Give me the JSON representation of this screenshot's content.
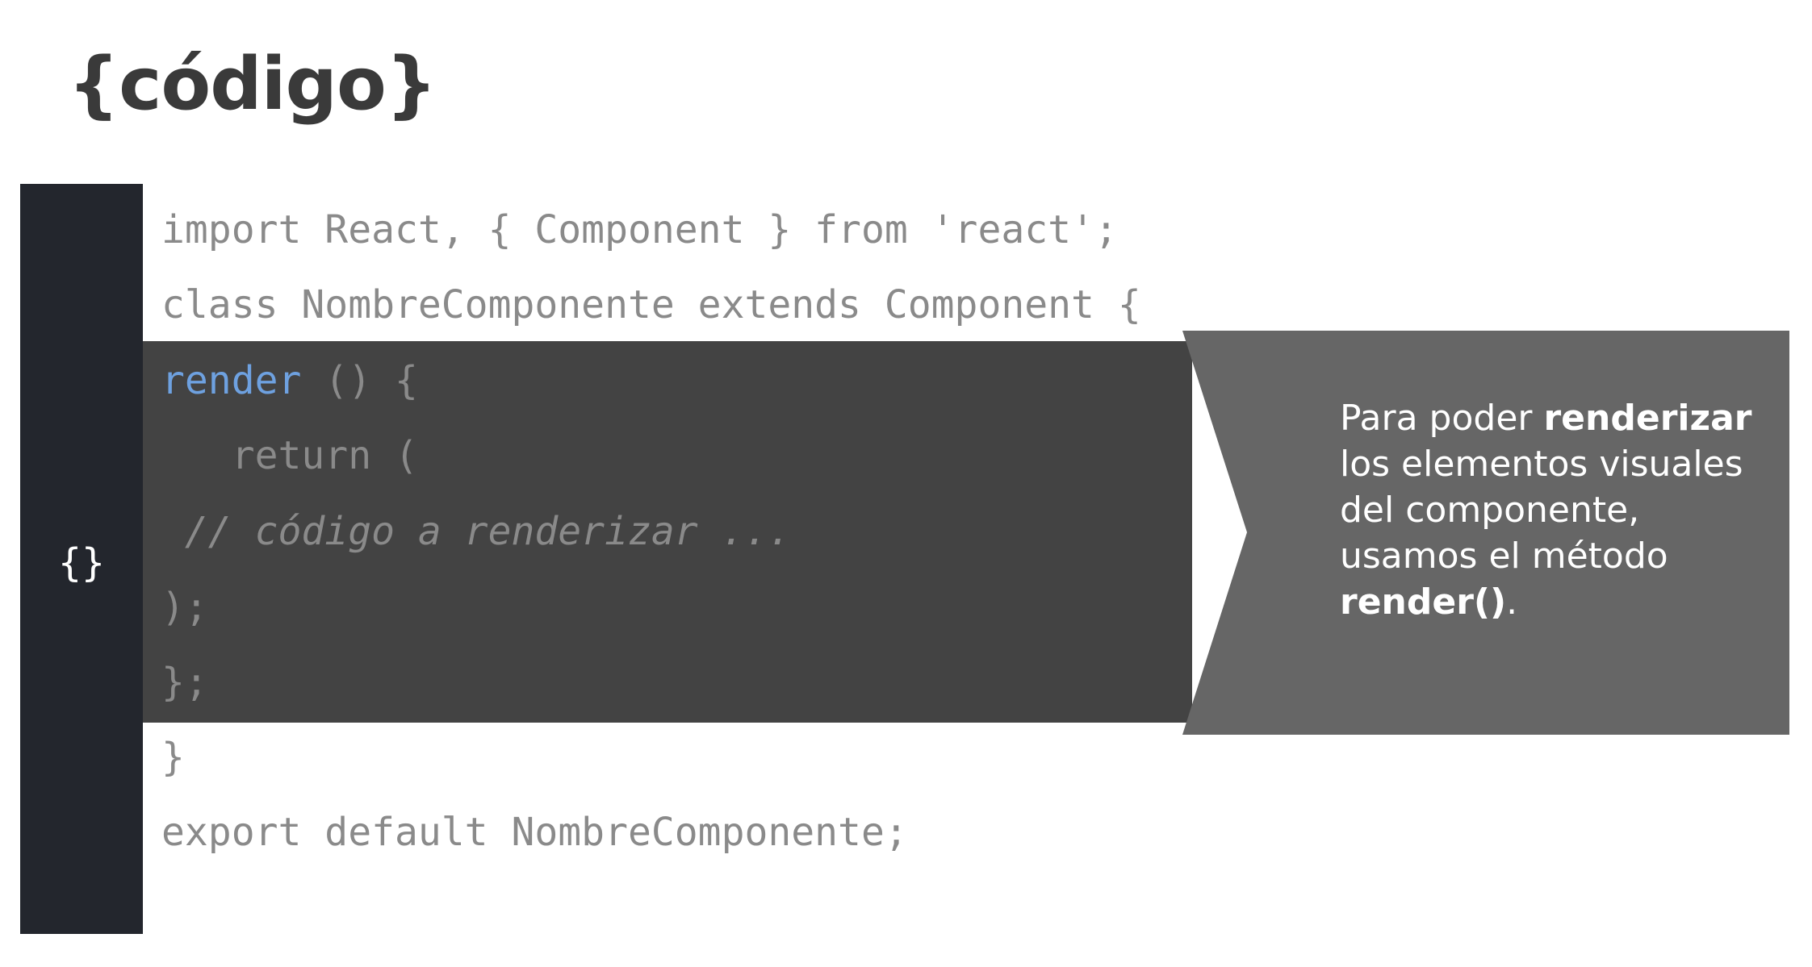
{
  "title": "{código}",
  "sidebar": {
    "icon": "braces-icon",
    "glyph": "{}"
  },
  "code": {
    "line1": "import React, { Component } from 'react';",
    "line2": "class NombreComponente extends Component {",
    "line3_keyword": "render",
    "line3_rest": " () {",
    "line4": "   return (",
    "line5": " // código a renderizar ...",
    "line6": ");",
    "line7": "};",
    "line8": "}",
    "line9": "export default NombreComponente;"
  },
  "callout": {
    "part1": "Para poder ",
    "bold1": "renderizar",
    "part2": " los elementos visuales del componente, usamos el método ",
    "bold2": "render()",
    "part3": "."
  },
  "colors": {
    "sidebar": "#23262d",
    "highlight": "#434343",
    "callout": "#666666",
    "keyword": "#6ea1e0",
    "code_text": "#8a8a8a"
  }
}
